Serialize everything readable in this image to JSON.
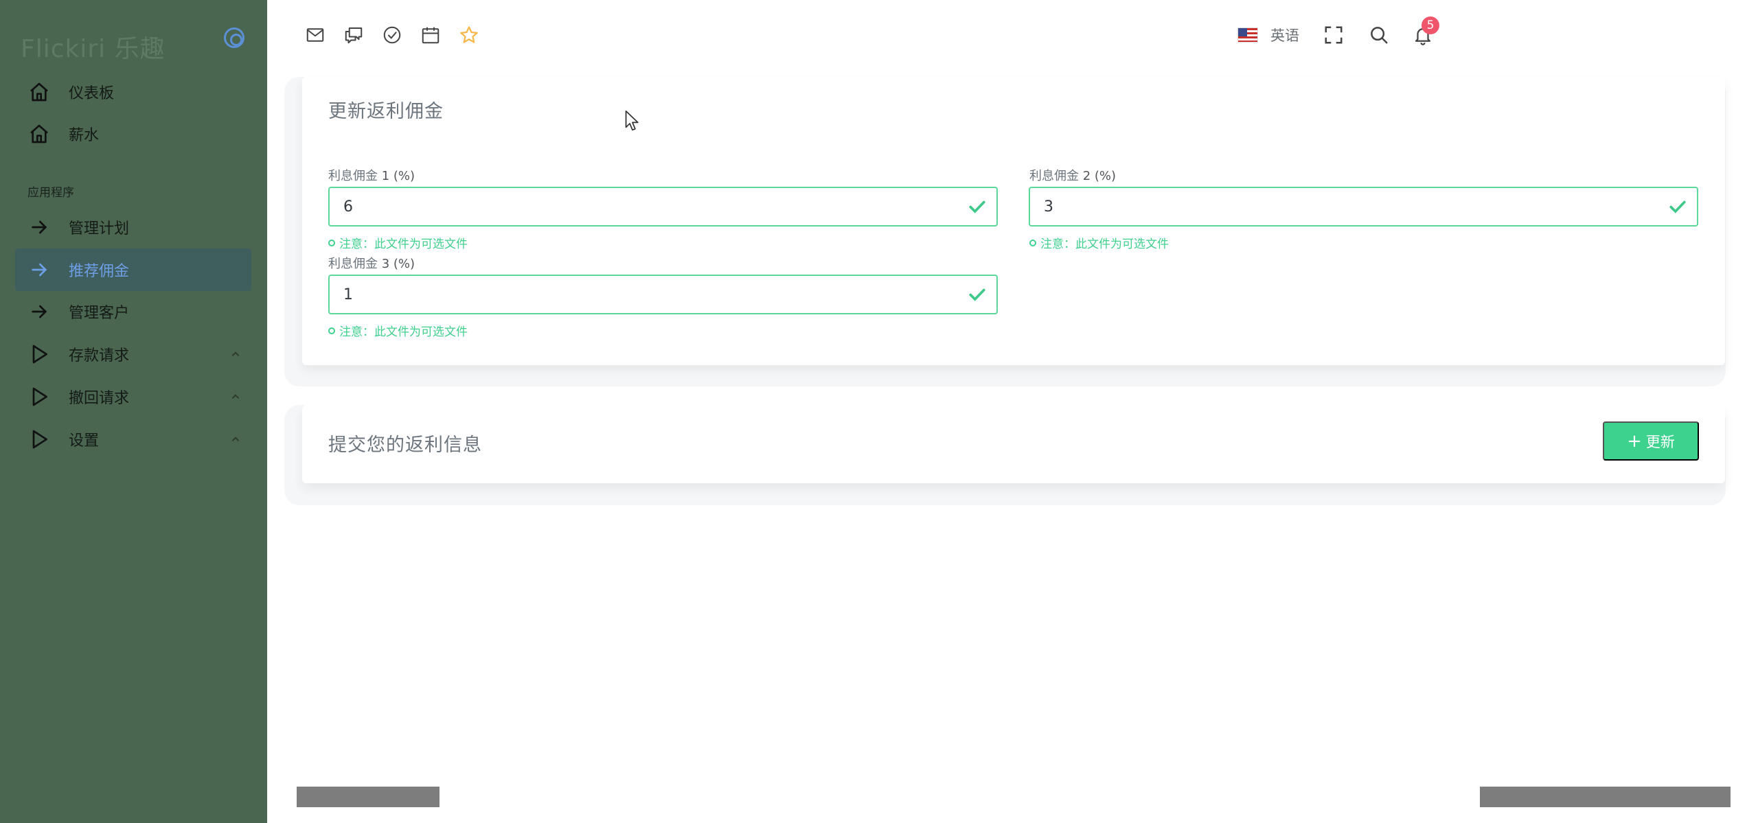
{
  "sidebar": {
    "brand": "Flickiri 乐趣",
    "section_label": "应用程序",
    "items": [
      {
        "label": "仪表板",
        "icon": "home-icon"
      },
      {
        "label": "薪水",
        "icon": "home-icon"
      },
      {
        "label": "管理计划",
        "icon": "arrow-right-icon"
      },
      {
        "label": "推荐佣金",
        "icon": "arrow-right-icon",
        "active": true
      },
      {
        "label": "管理客户",
        "icon": "arrow-right-icon"
      },
      {
        "label": "存款请求",
        "icon": "play-icon",
        "expandable": true
      },
      {
        "label": "撤回请求",
        "icon": "play-icon",
        "expandable": true
      },
      {
        "label": "设置",
        "icon": "play-icon",
        "expandable": true
      }
    ]
  },
  "topbar": {
    "icons": [
      "mail-icon",
      "chat-icon",
      "check-circle-icon",
      "calendar-icon",
      "star-icon"
    ],
    "language": "英语",
    "notification_count": "5",
    "star_color": "#f7b84b"
  },
  "form_card": {
    "title": "更新返利佣金",
    "fields": [
      {
        "label": "利息佣金",
        "label_suffix": "1 (%)",
        "value": "6",
        "note": "注意：此文件为可选文件"
      },
      {
        "label": "利息佣金",
        "label_suffix": "2 (%)",
        "value": "3",
        "note": "注意：此文件为可选文件"
      },
      {
        "label": "利息佣金",
        "label_suffix": "3 (%)",
        "value": "1",
        "note": "注意：此文件为可选文件"
      }
    ]
  },
  "submit_card": {
    "title": "提交您的返利信息",
    "button_plus": "+",
    "button_label": "更新"
  },
  "colors": {
    "sidebar_bg": "#4a6650",
    "active_item_bg": "#3f5e5e",
    "active_text": "#6d9fe6",
    "success": "#3ed28f",
    "badge": "#f1556c"
  }
}
